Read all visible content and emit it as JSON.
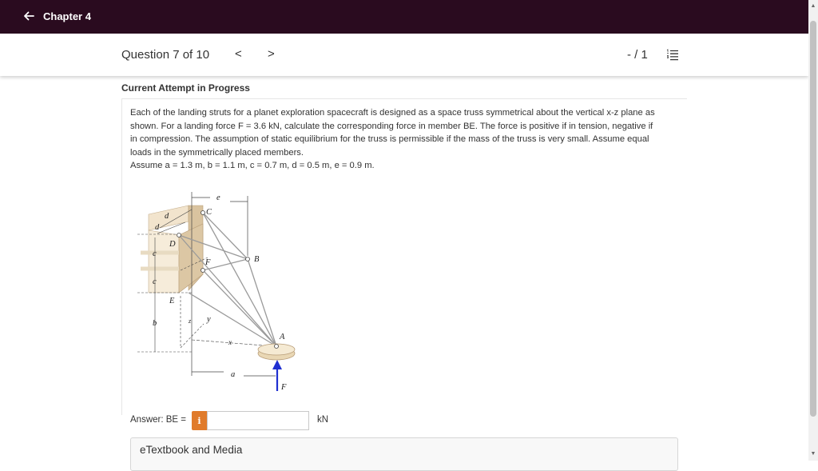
{
  "topbar": {
    "back_label": "Chapter 4"
  },
  "question_bar": {
    "title": "Question 7 of 10",
    "prev": "<",
    "next": ">",
    "score": "- / 1"
  },
  "attempt_status": "Current Attempt in Progress",
  "problem": {
    "line1": "Each of the landing struts for a planet exploration spacecraft is designed as a space truss symmetrical about the vertical x-z plane as",
    "line2": "shown. For a landing force F = 3.6 kN, calculate the corresponding force in member BE. The force is positive if in tension, negative if",
    "line3": "in compression. The assumption of static equilibrium for the truss is permissible if the mass of the truss is very small. Assume equal",
    "line4": "loads in the symmetrically placed members.",
    "assume": "Assume a = 1.3 m, b = 1.1 m, c = 0.7 m, d = 0.5 m, e = 0.9 m."
  },
  "figure_labels": {
    "e": "e",
    "C": "C",
    "d1": "d",
    "d2": "d",
    "D": "D",
    "B": "B",
    "c1": "c",
    "F_point": "F",
    "c2": "c",
    "E": "E",
    "z": "z",
    "y": "y",
    "b": "b",
    "A": "A",
    "x": "x",
    "a": "a",
    "F_force": "F"
  },
  "answer": {
    "label": "Answer: BE =",
    "info": "i",
    "value": "",
    "unit": "kN"
  },
  "etextbook": "eTextbook and Media",
  "colors": {
    "topbar": "#2a0b1f",
    "info_button": "#e07b2b",
    "force_arrow": "#1f2fd1"
  }
}
